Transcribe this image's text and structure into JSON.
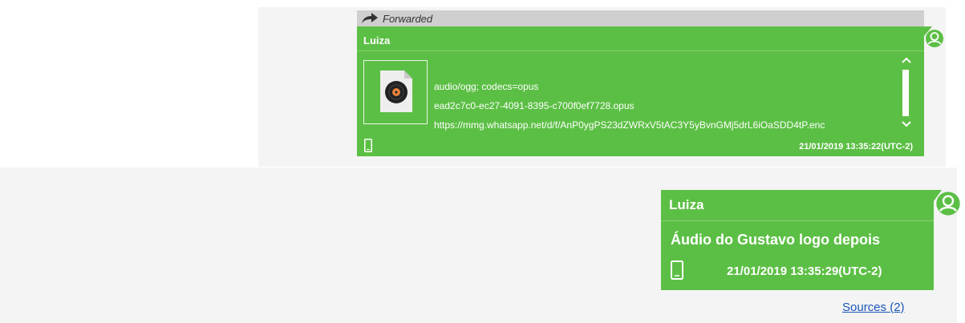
{
  "messages": [
    {
      "forwarded_label": "Forwarded",
      "sender": "Luiza",
      "attachment": {
        "mime": "audio/ogg; codecs=opus",
        "filename": "ead2c7c0-ec27-4091-8395-c700f0ef7728.opus",
        "url": "https://mmg.whatsapp.net/d/f/AnP0ygPS23dZWRxV5tAC3Y5yBvnGMj5drL6iOaSDD4tP.enc"
      },
      "timestamp": "21/01/2019 13:35:22(UTC-2)"
    },
    {
      "sender": "Luiza",
      "text": "Áudio do Gustavo logo depois",
      "timestamp": "21/01/2019 13:35:29(UTC-2)"
    }
  ],
  "sources_link": "Sources (2)",
  "icons": [
    "forward-arrow-icon",
    "audio-file-icon",
    "phone-icon",
    "avatar-icon",
    "scroll-up-icon",
    "scroll-down-icon"
  ],
  "colors": {
    "bubble": "#5cbf45",
    "forwarded_bar": "#cfcfcf",
    "avatar": "#5cbf45",
    "link": "#1a56b8"
  }
}
